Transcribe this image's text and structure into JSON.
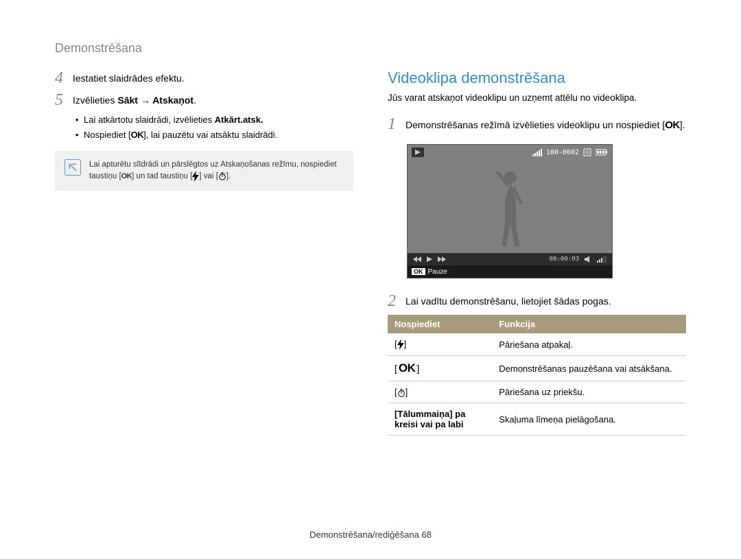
{
  "header": "Demonstrēšana",
  "left": {
    "step4_num": "4",
    "step4_text": "Iestatiet slaidrādes efektu.",
    "step5_num": "5",
    "step5_pre": "Izvēlieties ",
    "step5_bold": "Sākt → Atskaņot",
    "step5_post": ".",
    "bullet1_pre": "Lai atkārtotu slaidrādi, izvēlieties ",
    "bullet1_bold": "Atkārt.atsk.",
    "bullet2_pre": "Nospiediet [",
    "bullet2_ok": "OK",
    "bullet2_post": "], lai pauzētu vai atsāktu slaidrādi.",
    "note_p1": "Lai apturētu slīdrādi un pārslēgtos uz Atskaņošanas režīmu, nospiediet taustiņu [",
    "note_ok": "OK",
    "note_p2": "] un tad taustiņu [",
    "note_p3": "] vai [",
    "note_p4": "]."
  },
  "right": {
    "title": "Videoklipa demonstrēšana",
    "intro": "Jūs varat atskaņot videoklipu un uzņemt attēlu no videoklipa.",
    "step1_num": "1",
    "step1_pre": "Demonstrēšanas režīmā izvēlieties videoklipu un nospiediet [",
    "step1_ok": "OK",
    "step1_post": "].",
    "overlay_counter": "100-0002",
    "overlay_time": "00:00:03",
    "overlay_ok": "OK",
    "overlay_pause": "Pauze",
    "step2_num": "2",
    "step2_text": "Lai vadītu demonstrēšanu, lietojiet šādas pogas.",
    "th1": "Nospiediet",
    "th2": "Funkcija",
    "row1_fn": "Pāriešana atpakaļ.",
    "row2_ok": "OK",
    "row2_fn": "Demonstrēšanas pauzēšana vai atsākšana.",
    "row3_fn": "Pāriešana uz priekšu.",
    "row4_key": "[Tālummaiņa] pa kreisi vai pa labi",
    "row4_fn": "Skaļuma līmeņa pielāgošana."
  },
  "footer_pre": "Demonstrēšana/rediģēšana  ",
  "footer_num": "68"
}
